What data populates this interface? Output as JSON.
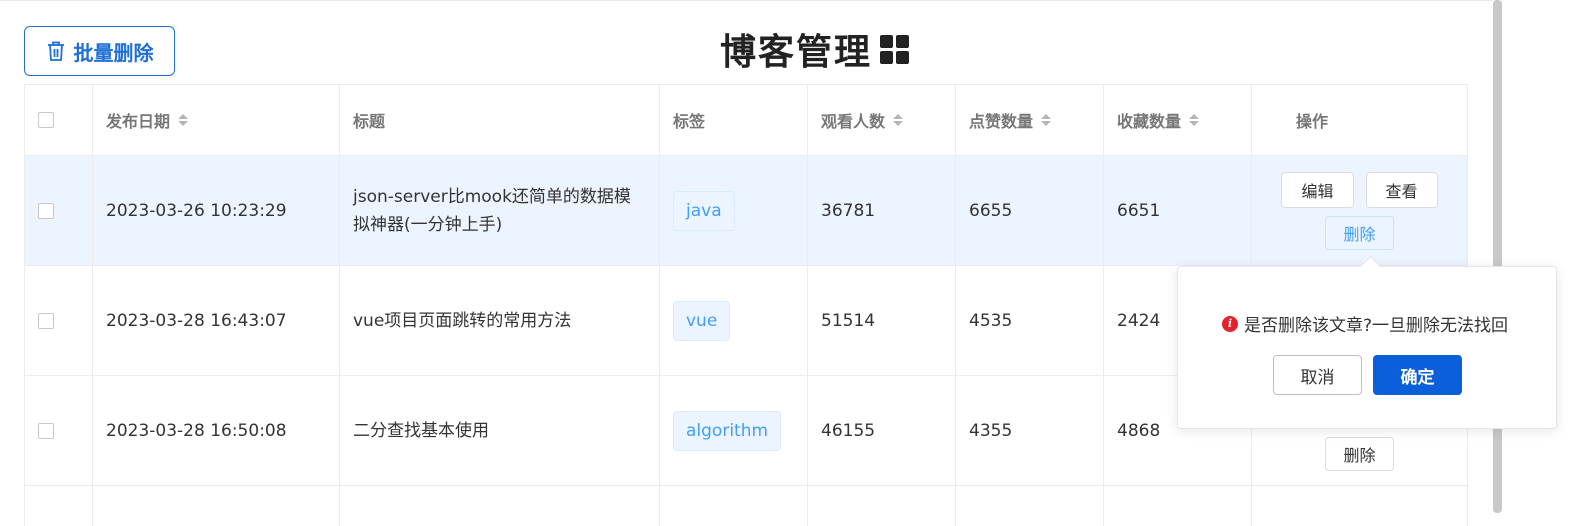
{
  "toolbar": {
    "bulk_delete_label": "批量删除",
    "bulk_delete_icon": "trash-icon"
  },
  "page": {
    "title": "博客管理",
    "title_icon": "grid-icon"
  },
  "table": {
    "columns": [
      "发布日期",
      "标题",
      "标签",
      "观看人数",
      "点赞数量",
      "收藏数量",
      "操作"
    ],
    "rows": [
      {
        "date": "2023-03-26 10:23:29",
        "title": "json-server比mook还简单的数据模拟神器(一分钟上手)",
        "tag": "java",
        "views": "36781",
        "likes": "6655",
        "favorites": "6651"
      },
      {
        "date": "2023-03-28 16:43:07",
        "title": "vue项目页面跳转的常用方法",
        "tag": "vue",
        "views": "51514",
        "likes": "4535",
        "favorites": "2424"
      },
      {
        "date": "2023-03-28 16:50:08",
        "title": "二分查找基本使用",
        "tag": "algorithm",
        "views": "46155",
        "likes": "4355",
        "favorites": "4868"
      }
    ],
    "actions": {
      "edit": "编辑",
      "view": "查看",
      "delete": "删除"
    }
  },
  "popconfirm": {
    "message": "是否删除该文章?一旦删除无法找回",
    "icon": "info-icon",
    "cancel": "取消",
    "confirm": "确定"
  },
  "colors": {
    "primary": "#1f6fd6",
    "confirm": "#0b5fd9",
    "row_highlight": "#ecf4ff",
    "warning_icon": "#e8202a"
  }
}
